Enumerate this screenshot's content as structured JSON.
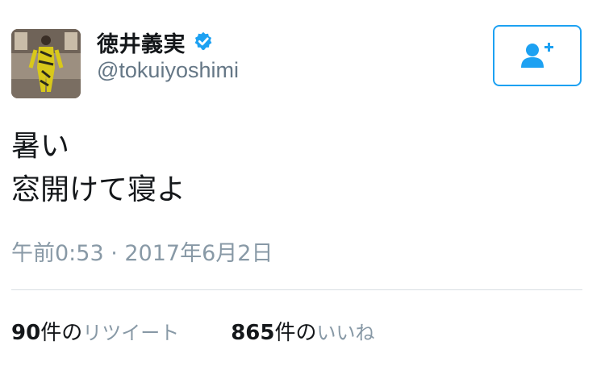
{
  "profile": {
    "display_name": "徳井義実",
    "handle": "@tokuiyoshimi",
    "verified": true,
    "avatar_icon": "user-avatar-photo",
    "verified_icon": "verified-badge-icon"
  },
  "follow_button": {
    "icon": "add-user-icon"
  },
  "tweet": {
    "lines": [
      "暑い",
      "窓開けて寝よ"
    ],
    "timestamp": "午前0:53 · 2017年6月2日"
  },
  "stats": {
    "retweets": {
      "count": "90",
      "suffix": "件の",
      "label": "リツイート"
    },
    "likes": {
      "count": "865",
      "suffix": "件の",
      "label": "いいね"
    }
  },
  "colors": {
    "accent": "#1da1f2",
    "text": "#14171a",
    "secondary": "#657786",
    "muted": "#8899a6",
    "divider": "#d8dee3"
  }
}
